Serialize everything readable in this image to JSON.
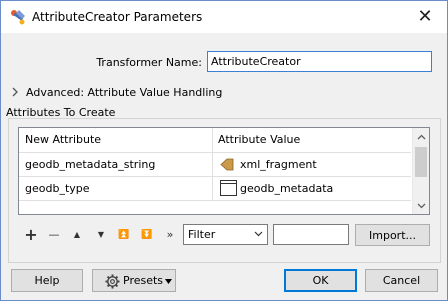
{
  "window": {
    "title": "AttributeCreator Parameters",
    "close_glyph": "✕"
  },
  "transformer_name": {
    "label": "Transformer Name:",
    "value": "AttributeCreator"
  },
  "advanced": {
    "label": "Advanced: Attribute Value Handling",
    "expanded": false
  },
  "attributes_group": {
    "title": "Attributes To Create",
    "columns": [
      "New Attribute",
      "Attribute Value"
    ],
    "rows": [
      {
        "attribute": "geodb_metadata_string",
        "value": "xml_fragment",
        "value_icon": "xml-fragment-icon"
      },
      {
        "attribute": "geodb_type",
        "value": "geodb_metadata",
        "value_icon": "constant-box-icon"
      }
    ]
  },
  "toolbar": {
    "add": "+",
    "remove": "—",
    "move_up": "▲",
    "move_down": "▼",
    "move_top": "⏫",
    "move_bottom": "⏬",
    "more": "»",
    "filter_selected": "Filter",
    "filter_text": "",
    "import_label": "Import..."
  },
  "footer": {
    "help_label": "Help",
    "presets_label": "Presets",
    "ok_label": "OK",
    "cancel_label": "Cancel"
  },
  "colors": {
    "accent": "#0078d7",
    "xml_icon": "#c89a4a"
  }
}
